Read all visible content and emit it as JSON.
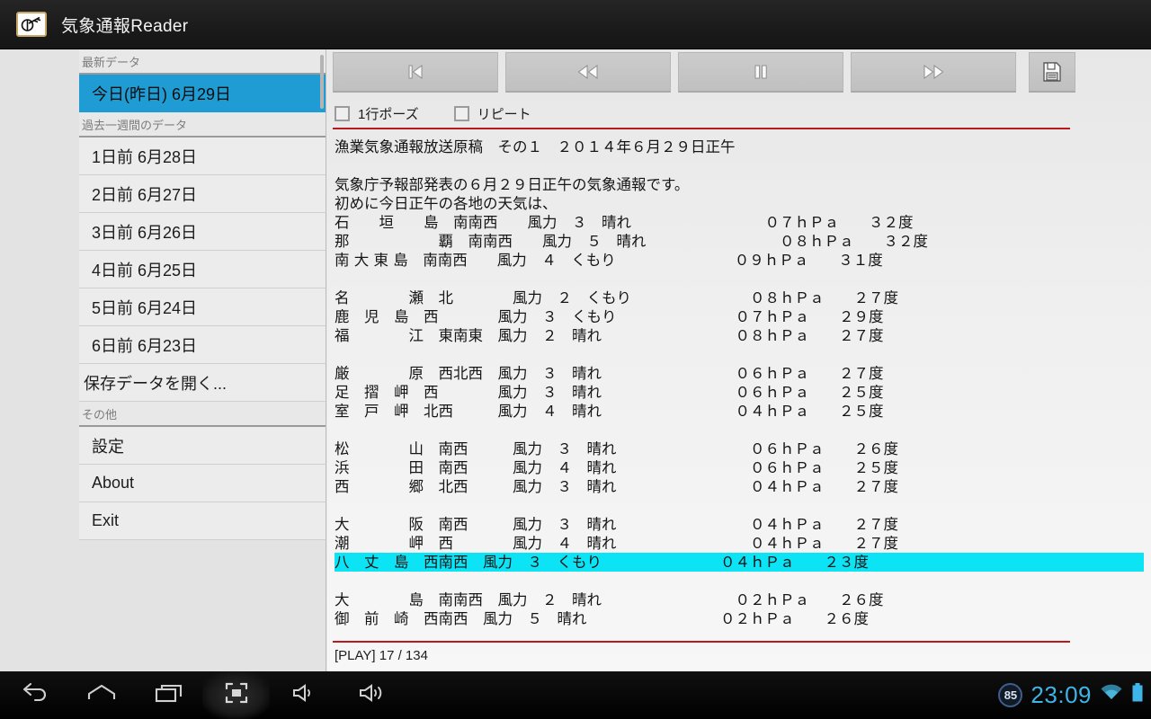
{
  "app": {
    "title": "気象通報Reader",
    "icon": "weather-vane-icon"
  },
  "sidebar": {
    "sections": [
      {
        "header": "最新データ",
        "items": [
          {
            "label": "今日(昨日) 6月29日",
            "selected": true
          }
        ]
      },
      {
        "header": "過去一週間のデータ",
        "items": [
          {
            "label": "1日前 6月28日",
            "selected": false
          },
          {
            "label": "2日前 6月27日",
            "selected": false
          },
          {
            "label": "3日前 6月26日",
            "selected": false
          },
          {
            "label": "4日前 6月25日",
            "selected": false
          },
          {
            "label": "5日前 6月24日",
            "selected": false
          },
          {
            "label": "6日前 6月23日",
            "selected": false
          },
          {
            "label": "保存データを開く...",
            "selected": false
          }
        ]
      },
      {
        "header": "その他",
        "items": [
          {
            "label": "設定",
            "selected": false
          },
          {
            "label": "About",
            "selected": false
          },
          {
            "label": "Exit",
            "selected": false
          }
        ]
      }
    ]
  },
  "toolbar": {
    "buttons": [
      {
        "name": "skip-to-start-button",
        "icon": "skip-previous-icon"
      },
      {
        "name": "rewind-button",
        "icon": "rewind-icon"
      },
      {
        "name": "pause-button",
        "icon": "pause-icon"
      },
      {
        "name": "fast-forward-button",
        "icon": "fast-forward-icon"
      },
      {
        "name": "save-button",
        "icon": "floppy-disk-icon"
      }
    ]
  },
  "options": {
    "line_pause": {
      "label": "1行ポーズ",
      "checked": false
    },
    "repeat": {
      "label": "リピート",
      "checked": false
    }
  },
  "content": {
    "lines": [
      {
        "text": "漁業気象通報放送原稿　その１　２０１４年６月２９日正午",
        "highlight": false
      },
      {
        "text": "",
        "highlight": false
      },
      {
        "text": "気象庁予報部発表の６月２９日正午の気象通報です。",
        "highlight": false
      },
      {
        "text": "初めに今日正午の各地の天気は、",
        "highlight": false
      },
      {
        "text": "石　　垣　　島　南南西　　風力　３　晴れ　　　　　　　　　０７ｈＰａ　　３２度",
        "highlight": false
      },
      {
        "text": "那　　　　　　覇　南南西　　風力　５　晴れ　　　　　　　　　０８ｈＰａ　　３２度",
        "highlight": false
      },
      {
        "text": "南 大 東 島　南南西　　風力　４　くもり　　　　　　　　０９ｈＰａ　　３１度",
        "highlight": false
      },
      {
        "text": "",
        "highlight": false
      },
      {
        "text": "名　　　　瀬　北　　　　風力　２　くもり　　　　　　　　０８ｈＰａ　　２７度",
        "highlight": false
      },
      {
        "text": "鹿　児　島　西　　　　風力　３　くもり　　　　　　　　０７ｈＰａ　　２９度",
        "highlight": false
      },
      {
        "text": "福　　　　江　東南東　風力　２　晴れ　　　　　　　　　０８ｈＰａ　　２７度",
        "highlight": false
      },
      {
        "text": "",
        "highlight": false
      },
      {
        "text": "厳　　　　原　西北西　風力　３　晴れ　　　　　　　　　０６ｈＰａ　　２７度",
        "highlight": false
      },
      {
        "text": "足　摺　岬　西　　　　風力　３　晴れ　　　　　　　　　０６ｈＰａ　　２５度",
        "highlight": false
      },
      {
        "text": "室　戸　岬　北西　　　風力　４　晴れ　　　　　　　　　０４ｈＰａ　　２５度",
        "highlight": false
      },
      {
        "text": "",
        "highlight": false
      },
      {
        "text": "松　　　　山　南西　　　風力　３　晴れ　　　　　　　　　０６ｈＰａ　　２６度",
        "highlight": false
      },
      {
        "text": "浜　　　　田　南西　　　風力　４　晴れ　　　　　　　　　０６ｈＰａ　　２５度",
        "highlight": false
      },
      {
        "text": "西　　　　郷　北西　　　風力　３　晴れ　　　　　　　　　０４ｈＰａ　　２７度",
        "highlight": false
      },
      {
        "text": "",
        "highlight": false
      },
      {
        "text": "大　　　　阪　南西　　　風力　３　晴れ　　　　　　　　　０４ｈＰａ　　２７度",
        "highlight": false
      },
      {
        "text": "潮　　　　岬　西　　　　風力　４　晴れ　　　　　　　　　０４ｈＰａ　　２７度",
        "highlight": false
      },
      {
        "text": "八　丈　島　西南西　風力　３　くもり　　　　　　　　０４ｈＰａ　　２３度",
        "highlight": true
      },
      {
        "text": "",
        "highlight": false
      },
      {
        "text": "大　　　　島　南南西　風力　２　晴れ　　　　　　　　　０２ｈＰａ　　２６度",
        "highlight": false
      },
      {
        "text": "御　前　崎　西南西　風力　５　晴れ　　　　　　　　　０２ｈＰａ　　２６度",
        "highlight": false
      }
    ]
  },
  "status": {
    "text": "[PLAY] 17 / 134"
  },
  "navbar": {
    "buttons": [
      {
        "name": "back-button",
        "icon": "back-arrow-icon"
      },
      {
        "name": "home-button",
        "icon": "home-icon"
      },
      {
        "name": "recent-apps-button",
        "icon": "recent-apps-icon"
      },
      {
        "name": "screenshot-button",
        "icon": "screenshot-icon"
      },
      {
        "name": "volume-down-button",
        "icon": "volume-down-icon"
      },
      {
        "name": "volume-up-button",
        "icon": "volume-up-icon"
      }
    ],
    "battery_percent": "85",
    "clock": "23:09",
    "wifi_icon": "wifi-icon",
    "battery_icon": "battery-full-icon"
  },
  "colors": {
    "accent_blue": "#1f9cd4",
    "highlight_cyan": "#0ce3f5",
    "rule_red": "#b81a20",
    "clock_blue": "#3fb4e8"
  }
}
